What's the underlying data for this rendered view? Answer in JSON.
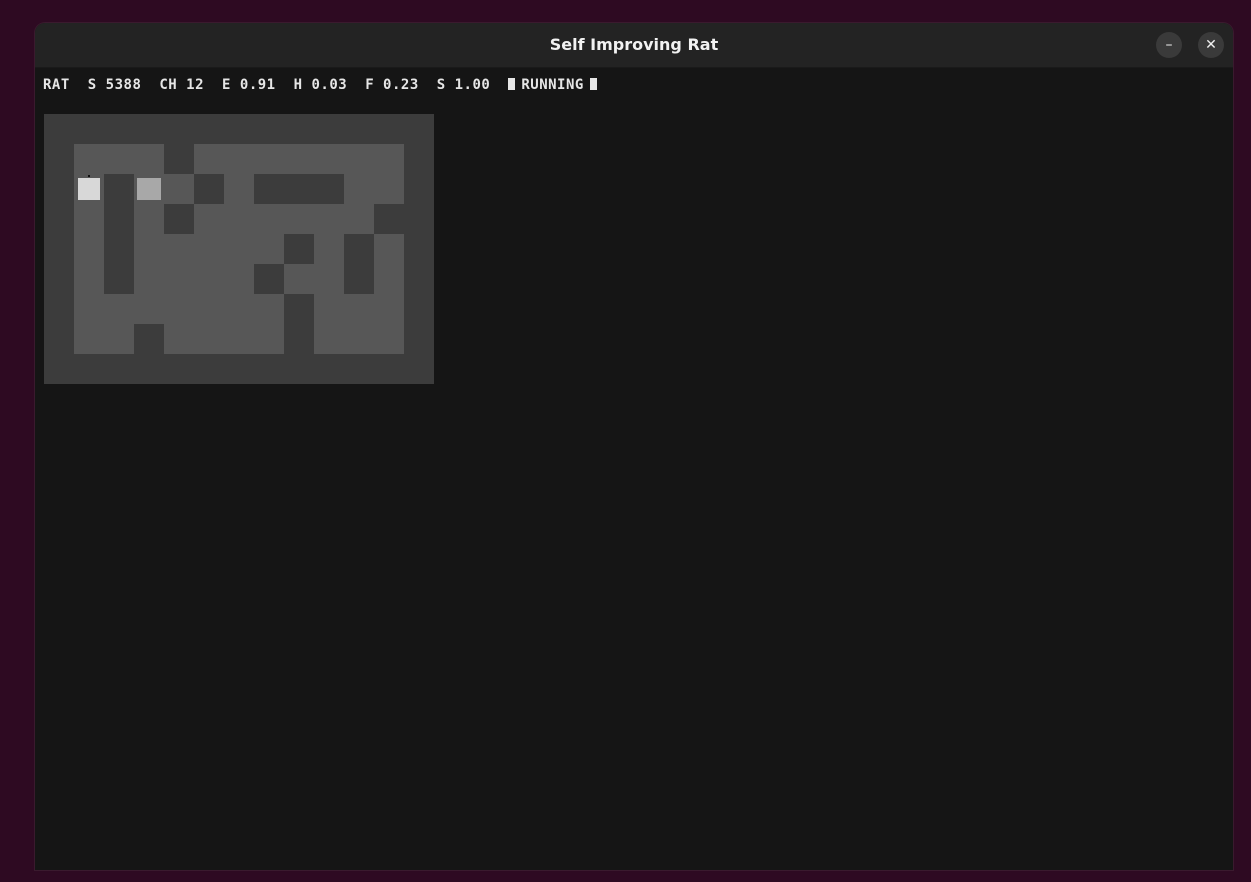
{
  "window": {
    "title": "Self Improving Rat",
    "minimize_label": "–",
    "close_label": "✕"
  },
  "hud": {
    "name": "RAT",
    "steps": "S 5388",
    "ch": "CH 12",
    "e": "E 0.91",
    "h": "H 0.03",
    "f": "F 0.23",
    "s": "S 1.00",
    "status": "RUNNING"
  },
  "colors": {
    "wall": "#3c3c3c",
    "path": "#575757",
    "rat": "#d8d8d8",
    "goal": "#a8a8a8"
  },
  "maze": {
    "grid": [
      "#############",
      "#...#.......#",
      "#.#..#.###..#",
      "#.#.#......##",
      "#.#.....#.#.#",
      "#.#....#..#.#",
      "#.......#...#",
      "#..#....#...#",
      "#############"
    ]
  }
}
